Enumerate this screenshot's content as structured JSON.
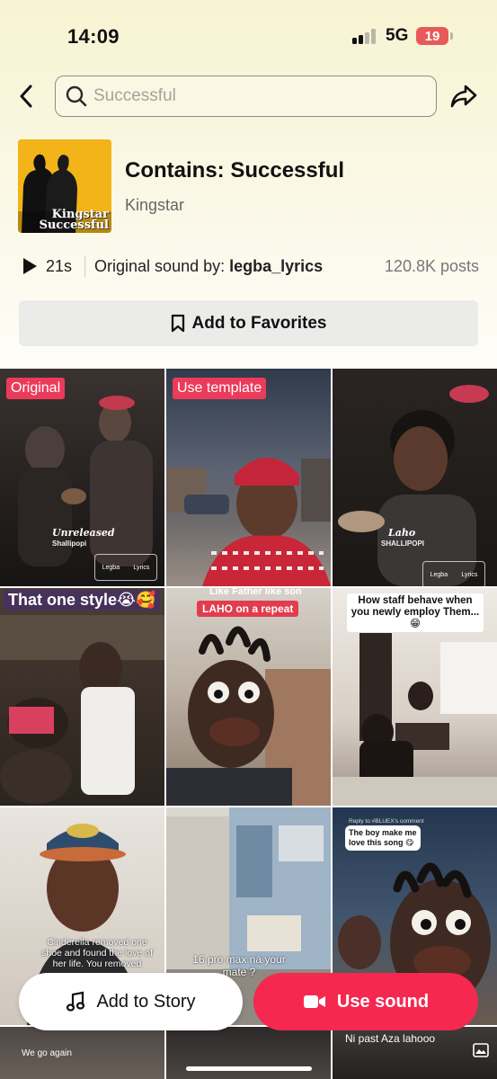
{
  "status_bar": {
    "time": "14:09",
    "network": "5G",
    "battery": "19"
  },
  "header": {
    "search_placeholder": "Successful"
  },
  "sound": {
    "title": "Contains: Successful",
    "artist": "Kingstar",
    "cover_text_line1": "Kingstar",
    "cover_text_line2": "Successful",
    "duration": "21s",
    "original_by_prefix": "Original sound by: ",
    "original_by_user": "legba_lyrics",
    "posts": "120.8K posts"
  },
  "favorites_label": "Add to Favorites",
  "grid": {
    "tiles": [
      {
        "badge": "Original",
        "caption": "Unreleased",
        "subcaption": "Shallipopi",
        "logo_left": "Legba",
        "logo_right": "Lyrics"
      },
      {
        "badge": "Use template"
      },
      {
        "caption": "Laho",
        "subcaption": "SHALLIPOPI",
        "logo_left": "Legba",
        "logo_right": "Lyrics"
      },
      {
        "caption": "That one style😭🥰"
      },
      {
        "caption_top": "Like Father like son",
        "caption": "LAHO on a repeat"
      },
      {
        "caption": "How staff behave when you newly employ Them...😁"
      },
      {
        "caption": "Cinderella removed one shoe and found the love of her life. You removed"
      },
      {
        "caption": "16 pro max nà your mate ?"
      },
      {
        "reply": "Reply to #BLUEX's comment",
        "caption": "The boy make me love this song 😋"
      },
      {
        "caption": "We go again"
      },
      {
        "caption": ""
      },
      {
        "caption": "Ni past Aza lahooo"
      }
    ]
  },
  "actions": {
    "add_story": "Add to Story",
    "use_sound": "Use sound"
  },
  "colors": {
    "accent": "#f5284f",
    "badge": "#ec3b5a"
  }
}
